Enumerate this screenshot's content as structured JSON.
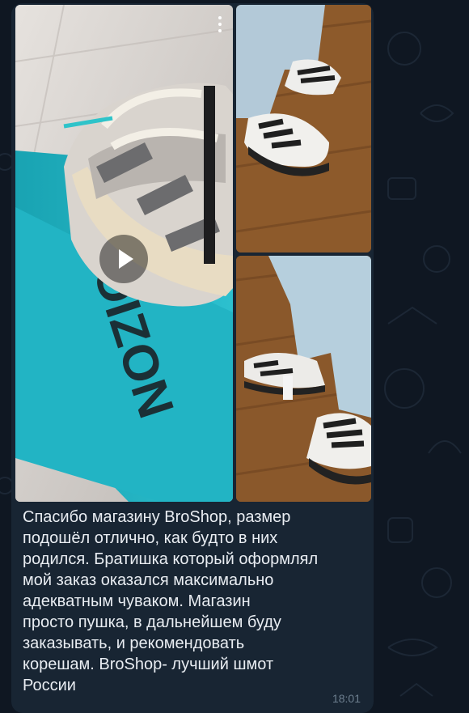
{
  "message": {
    "text": "Спасибо магазину BroShop, размер\nподошёл отлично, как будто в них\nродился. Братишка который оформлял\nмой заказ оказался максимально\nадекватным чуваком. Магазин\nпросто пушка, в дальнейшем буду\nзаказывать, и рекомендовать\nкорешам. BroShop- лучший шмот\nРоссии",
    "time": "18:01"
  },
  "media": {
    "items": [
      {
        "type": "video",
        "icon": "play-icon",
        "box_text": "POIZON"
      },
      {
        "type": "photo"
      },
      {
        "type": "photo"
      }
    ],
    "menu_icon": "more-vertical-icon"
  },
  "colors": {
    "background": "#0e1621",
    "bubble": "#182533",
    "text": "#e9edf2",
    "time": "#6d7f8f"
  }
}
